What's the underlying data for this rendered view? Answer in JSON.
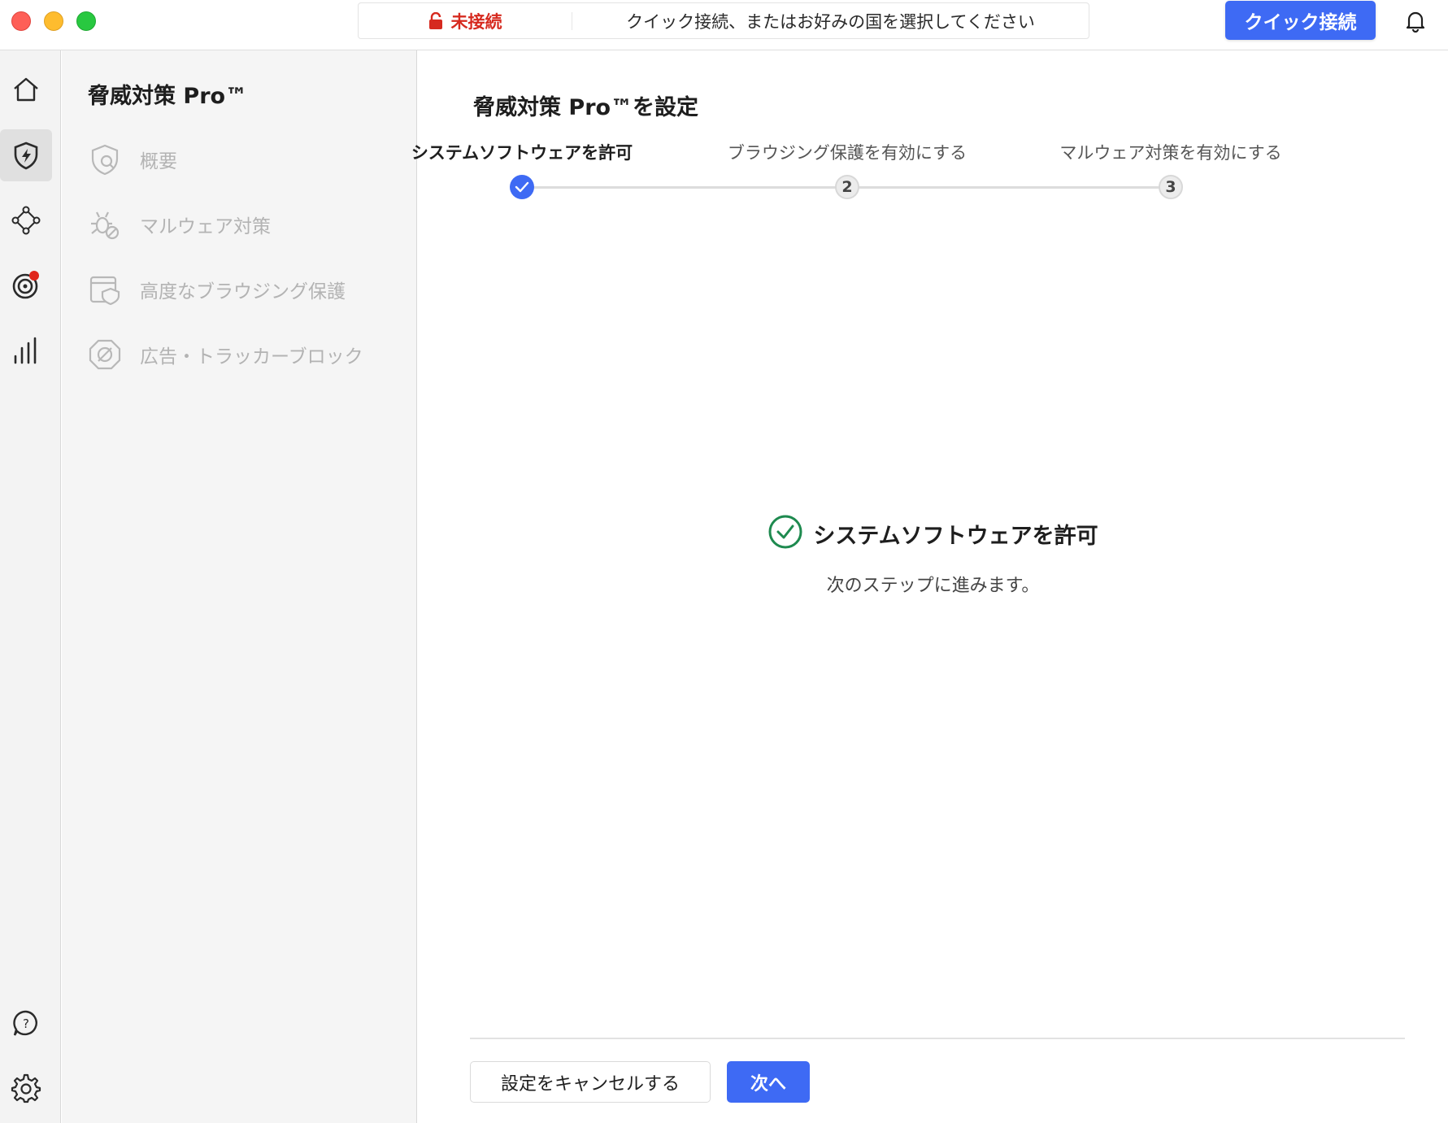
{
  "titlebar": {
    "status": "未接続",
    "hint": "クイック接続、またはお好みの国を選択してください",
    "quick_connect": "クイック接続"
  },
  "colors": {
    "accent": "#3e6af4",
    "status_red": "#d62a1f",
    "success_green": "#1e8a4f"
  },
  "rail": {
    "items": [
      {
        "icon": "home-icon"
      },
      {
        "icon": "shield-lightning-icon",
        "active": true
      },
      {
        "icon": "meshnet-icon"
      },
      {
        "icon": "dark-web-target-icon",
        "badge": true
      },
      {
        "icon": "stats-bars-icon"
      }
    ],
    "bottom": [
      {
        "icon": "help-chat-icon"
      },
      {
        "icon": "settings-gear-icon"
      }
    ]
  },
  "subnav": {
    "title": "脅威対策 Pro™",
    "items": [
      {
        "label": "概要",
        "icon": "shield-search-icon"
      },
      {
        "label": "マルウェア対策",
        "icon": "bug-block-icon"
      },
      {
        "label": "高度なブラウジング保護",
        "icon": "browser-shield-icon"
      },
      {
        "label": "広告・トラッカーブロック",
        "icon": "ad-block-icon"
      }
    ]
  },
  "main": {
    "title": "脅威対策 Pro™を設定",
    "steps": [
      {
        "label": "システムソフトウェアを許可",
        "number": "",
        "state": "done"
      },
      {
        "label": "ブラウジング保護を有効にする",
        "number": "2",
        "state": "todo"
      },
      {
        "label": "マルウェア対策を有効にする",
        "number": "3",
        "state": "todo"
      }
    ],
    "result_title": "システムソフトウェアを許可",
    "result_sub": "次のステップに進みます。",
    "cancel": "設定をキャンセルする",
    "next": "次へ"
  }
}
